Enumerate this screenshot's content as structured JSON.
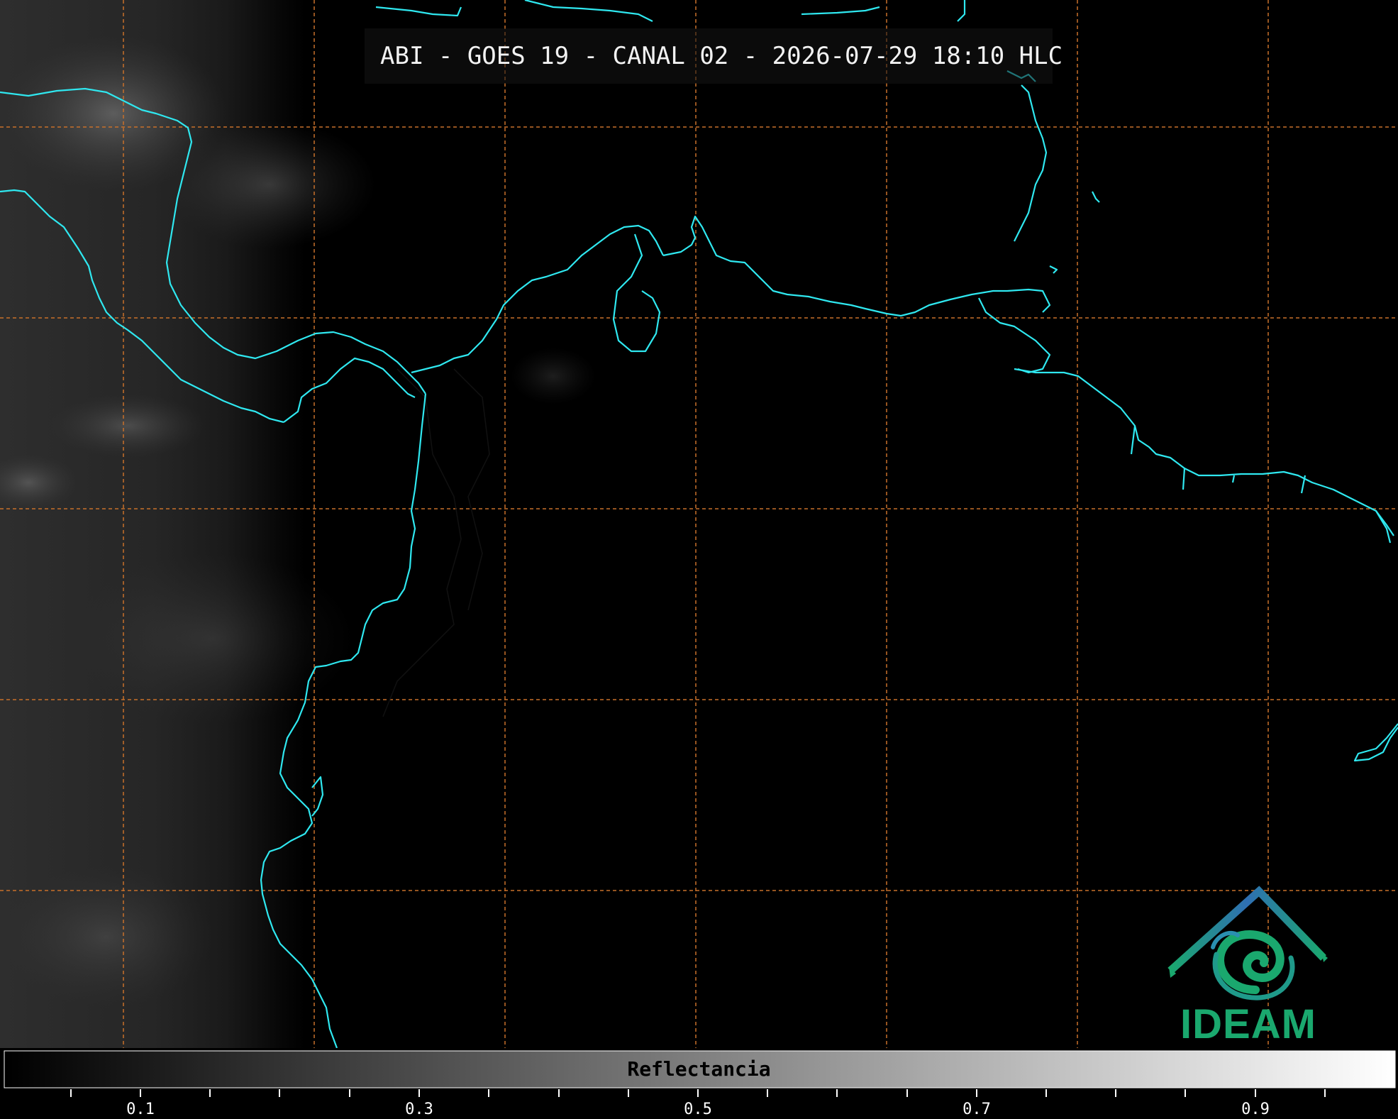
{
  "title": "ABI - GOES 19 - CANAL 02 - 2026-07-29 18:10 HLC",
  "colorbar": {
    "label": "Reflectancia",
    "ticks": [
      "0.1",
      "0.3",
      "0.5",
      "0.7",
      "0.9"
    ]
  },
  "logo": {
    "text": "IDEAM"
  },
  "colors": {
    "coastline": "#2fe8f0",
    "grid": "#c8702a",
    "background": "#000000",
    "logo_blue": "#2f6fb3",
    "logo_green": "#1aa86e"
  }
}
